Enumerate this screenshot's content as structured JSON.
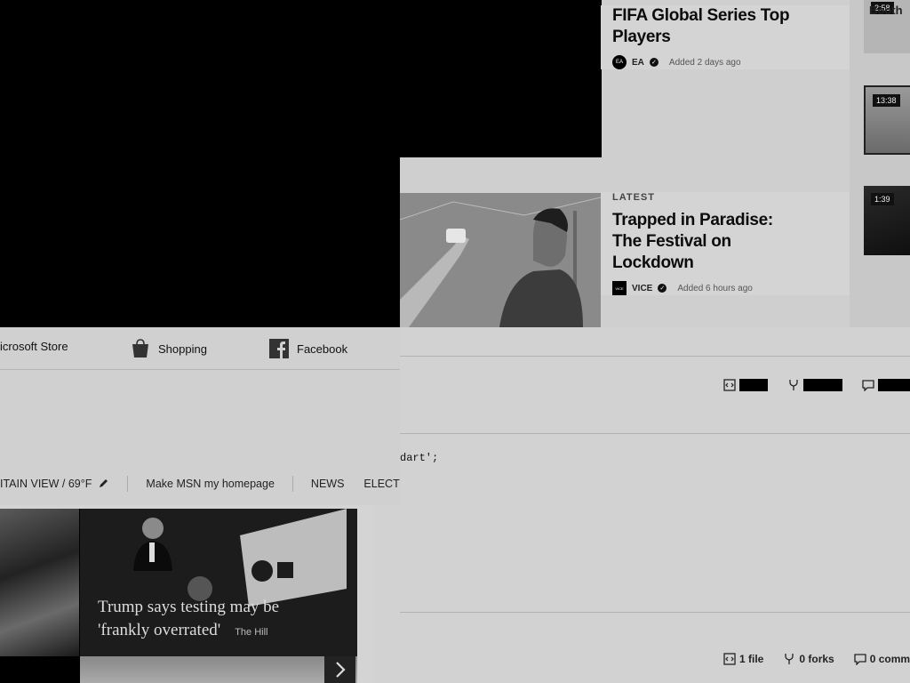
{
  "videos": {
    "items": [
      {
        "kicker": "",
        "title": "FIFA Global Series Top Players",
        "source": "EA",
        "source_logo": "EA",
        "added": "Added 2 days ago"
      },
      {
        "kicker": "LATEST",
        "title": "Trapped in Paradise: The Festival on Lockdown",
        "source": "VICE",
        "source_logo": "VICE",
        "added": "Added 6 hours ago"
      }
    ],
    "thumbs": [
      {
        "duration": "2:58",
        "label": "Booth"
      },
      {
        "duration": "13:38"
      },
      {
        "duration": "1:39"
      }
    ]
  },
  "msn": {
    "quick_links": [
      {
        "label": "icrosoft Store",
        "icon": "store-icon"
      },
      {
        "label": "Shopping",
        "icon": "shopping-bag-icon"
      },
      {
        "label": "Facebook",
        "icon": "facebook-icon"
      }
    ],
    "nav": {
      "location": "ITAIN VIEW / 69°F",
      "homepage": "Make MSN my homepage",
      "news": "NEWS",
      "elect": "ELECT"
    },
    "tile": {
      "caption_line1": "Trump says testing may be",
      "caption_line2": "'frankly overrated'",
      "source": "The Hill"
    }
  },
  "gist": {
    "code": "dart';",
    "footer": {
      "files": "1 file",
      "forks": "0 forks",
      "comments": "0 comme"
    }
  },
  "colors": {
    "page_bg": "#d4d4d4",
    "black": "#000000"
  }
}
